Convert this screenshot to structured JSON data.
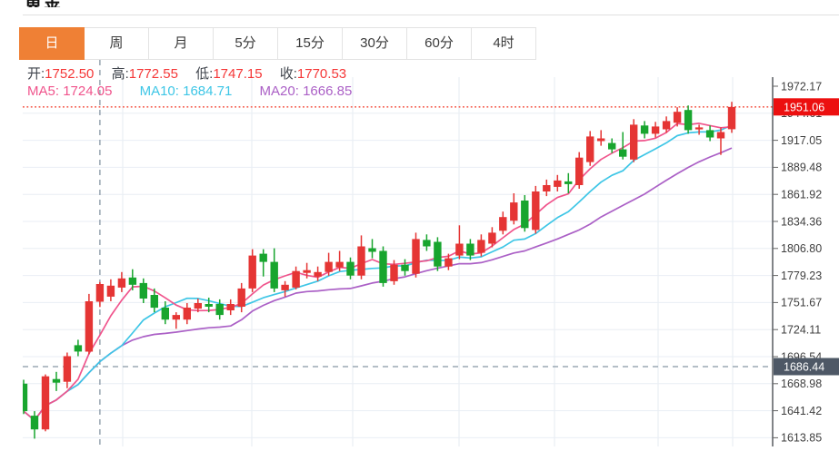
{
  "page": {
    "title": "黄金"
  },
  "toolbar": {
    "tabs": [
      {
        "label": "日",
        "selected": true
      },
      {
        "label": "周",
        "selected": false
      },
      {
        "label": "月",
        "selected": false
      },
      {
        "label": "5分",
        "selected": false
      },
      {
        "label": "15分",
        "selected": false
      },
      {
        "label": "30分",
        "selected": false
      },
      {
        "label": "60分",
        "selected": false
      },
      {
        "label": "4时",
        "selected": false
      }
    ]
  },
  "info_bar": {
    "ohlc": [
      {
        "label": "开:",
        "value": "1752.50"
      },
      {
        "label": "高:",
        "value": "1772.55"
      },
      {
        "label": "低:",
        "value": "1747.15"
      },
      {
        "label": "收:",
        "value": "1770.53"
      }
    ],
    "ma": [
      {
        "label": "MA5:",
        "value": "1724.05"
      },
      {
        "label": "MA10:",
        "value": "1684.71"
      },
      {
        "label": "MA20:",
        "value": "1666.85"
      }
    ]
  },
  "colors": {
    "accent_orange": "#ef8035",
    "up_red": "#e53534",
    "down_green": "#18a52e",
    "ma5_pink": "#f0548c",
    "ma10_cyan": "#3ec6e6",
    "ma20_purple": "#ab60c6",
    "ohlc_value_red": "#f53838",
    "current_price_line": "#f55f50",
    "current_price_badge": "#ec0f0f",
    "crosshair_gray": "#8796a4",
    "crosshair_badge": "#4e5866",
    "grid_h": "#e9eef4",
    "grid_v": "#e4ebf2",
    "axis_line": "#2e3338",
    "axis_text": "#3f3f3f"
  },
  "chart_data": {
    "type": "candlestick",
    "title": "",
    "xlabel": "",
    "ylabel": "",
    "y_axis_ticks": [
      1972.17,
      1944.61,
      1917.05,
      1889.48,
      1861.92,
      1834.36,
      1806.8,
      1779.23,
      1751.67,
      1724.11,
      1696.54,
      1668.98,
      1641.42,
      1613.85
    ],
    "price_step": 27.56,
    "legend": [
      "MA5",
      "MA10",
      "MA20"
    ],
    "ma_periods": [
      5,
      10,
      20
    ],
    "markers": {
      "current_price": "1951.06",
      "crosshair_price": "1686.44",
      "crosshair_candle_index": 7
    },
    "candles_ohlc": [
      [
        1669.0,
        1673.0,
        1638.0,
        1641.0
      ],
      [
        1636.4,
        1641.0,
        1613.0,
        1622.4
      ],
      [
        1622.4,
        1678.4,
        1620.5,
        1676.5
      ],
      [
        1673.7,
        1681.0,
        1661.5,
        1670.0
      ],
      [
        1670.9,
        1700.7,
        1664.4,
        1697.0
      ],
      [
        1708.2,
        1713.8,
        1697.0,
        1701.7
      ],
      [
        1701.7,
        1760.5,
        1698.9,
        1753.0
      ],
      [
        1752.5,
        1772.55,
        1747.15,
        1770.53
      ],
      [
        1757.7,
        1775.4,
        1753.0,
        1768.9
      ],
      [
        1767.0,
        1782.8,
        1762.3,
        1776.3
      ],
      [
        1777.2,
        1785.6,
        1764.2,
        1769.8
      ],
      [
        1771.6,
        1776.3,
        1751.1,
        1755.8
      ],
      [
        1759.5,
        1766.0,
        1741.8,
        1746.5
      ],
      [
        1746.5,
        1753.0,
        1729.7,
        1734.3
      ],
      [
        1734.3,
        1741.8,
        1725.0,
        1739.0
      ],
      [
        1734.3,
        1751.1,
        1729.7,
        1746.5
      ],
      [
        1745.5,
        1755.8,
        1741.8,
        1751.1
      ],
      [
        1750.2,
        1756.7,
        1741.8,
        1747.4
      ],
      [
        1750.2,
        1754.9,
        1734.3,
        1739.0
      ],
      [
        1743.7,
        1754.9,
        1739.0,
        1750.2
      ],
      [
        1747.4,
        1771.6,
        1741.8,
        1766.0
      ],
      [
        1766.0,
        1806.1,
        1762.3,
        1799.6
      ],
      [
        1801.4,
        1806.1,
        1778.2,
        1793.1
      ],
      [
        1793.1,
        1807.0,
        1762.3,
        1766.0
      ],
      [
        1764.2,
        1773.5,
        1757.7,
        1769.8
      ],
      [
        1767.0,
        1788.4,
        1765.1,
        1783.8
      ],
      [
        1781.9,
        1792.1,
        1776.3,
        1784.7
      ],
      [
        1778.2,
        1788.4,
        1773.5,
        1782.8
      ],
      [
        1782.8,
        1802.4,
        1779.1,
        1793.1
      ],
      [
        1787.5,
        1804.3,
        1783.8,
        1793.1
      ],
      [
        1793.1,
        1797.7,
        1775.4,
        1779.1
      ],
      [
        1779.1,
        1820.1,
        1775.4,
        1808.9
      ],
      [
        1807.1,
        1816.4,
        1796.8,
        1803.4
      ],
      [
        1804.3,
        1808.9,
        1767.9,
        1771.6
      ],
      [
        1773.5,
        1795.0,
        1769.8,
        1790.3
      ],
      [
        1790.3,
        1795.9,
        1779.1,
        1783.8
      ],
      [
        1781.0,
        1822.9,
        1777.2,
        1816.4
      ],
      [
        1815.5,
        1821.1,
        1804.3,
        1808.9
      ],
      [
        1813.6,
        1818.3,
        1783.8,
        1788.4
      ],
      [
        1788.4,
        1801.4,
        1784.7,
        1796.8
      ],
      [
        1799.6,
        1830.4,
        1795.9,
        1811.7
      ],
      [
        1811.7,
        1816.4,
        1795.0,
        1799.6
      ],
      [
        1802.4,
        1821.1,
        1798.7,
        1815.5
      ],
      [
        1811.7,
        1828.5,
        1808.0,
        1822.9
      ],
      [
        1824.8,
        1844.4,
        1821.1,
        1838.8
      ],
      [
        1835.1,
        1863.0,
        1831.3,
        1853.7
      ],
      [
        1855.6,
        1861.2,
        1823.9,
        1827.6
      ],
      [
        1825.7,
        1870.5,
        1822.0,
        1864.9
      ],
      [
        1864.9,
        1877.0,
        1860.2,
        1871.4
      ],
      [
        1869.6,
        1881.7,
        1864.9,
        1876.1
      ],
      [
        1875.2,
        1883.6,
        1863.0,
        1872.4
      ],
      [
        1871.4,
        1905.0,
        1867.7,
        1899.4
      ],
      [
        1894.8,
        1926.5,
        1891.0,
        1920.9
      ],
      [
        1916.2,
        1927.4,
        1911.5,
        1919.0
      ],
      [
        1914.3,
        1919.0,
        1904.1,
        1907.8
      ],
      [
        1907.8,
        1925.5,
        1897.5,
        1900.3
      ],
      [
        1897.5,
        1938.6,
        1894.8,
        1933.0
      ],
      [
        1932.1,
        1936.7,
        1919.0,
        1923.7
      ],
      [
        1923.7,
        1935.8,
        1919.9,
        1931.1
      ],
      [
        1928.3,
        1941.4,
        1924.6,
        1936.7
      ],
      [
        1934.9,
        1950.7,
        1931.1,
        1946.1
      ],
      [
        1947.9,
        1952.6,
        1923.7,
        1927.4
      ],
      [
        1928.3,
        1933.0,
        1922.7,
        1930.2
      ],
      [
        1927.4,
        1932.1,
        1916.2,
        1919.9
      ],
      [
        1919.0,
        1930.2,
        1902.2,
        1925.5
      ],
      [
        1928.3,
        1956.3,
        1924.6,
        1951.0
      ]
    ]
  }
}
